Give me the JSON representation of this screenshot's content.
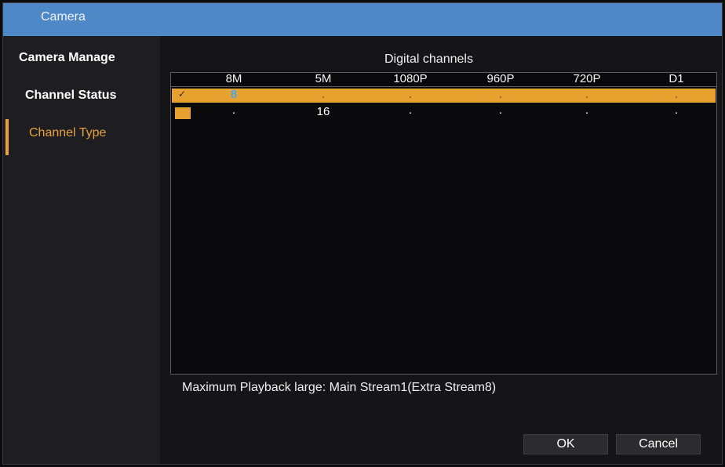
{
  "window": {
    "title": "Camera"
  },
  "sidebar": {
    "items": [
      {
        "label": "Camera Manage",
        "active": false
      },
      {
        "label": "Channel Status",
        "active": false
      },
      {
        "label": "Channel Type",
        "active": true
      }
    ]
  },
  "table": {
    "title": "Digital channels",
    "columns": [
      "8M",
      "5M",
      "1080P",
      "960P",
      "720P",
      "D1"
    ],
    "rows": [
      {
        "selected": true,
        "checked": true,
        "cells": [
          "8",
          ".",
          ".",
          ".",
          ".",
          "."
        ]
      },
      {
        "selected": false,
        "checked": false,
        "cells": [
          ".",
          "16",
          ".",
          ".",
          ".",
          "."
        ]
      }
    ]
  },
  "footer": {
    "info": "Maximum Playback large: Main Stream1(Extra Stream8)",
    "ok_label": "OK",
    "cancel_label": "Cancel"
  },
  "colors": {
    "accent": "#e7a12f",
    "titlebar": "#4f88c6",
    "highlight_value": "#4aa8e8"
  }
}
